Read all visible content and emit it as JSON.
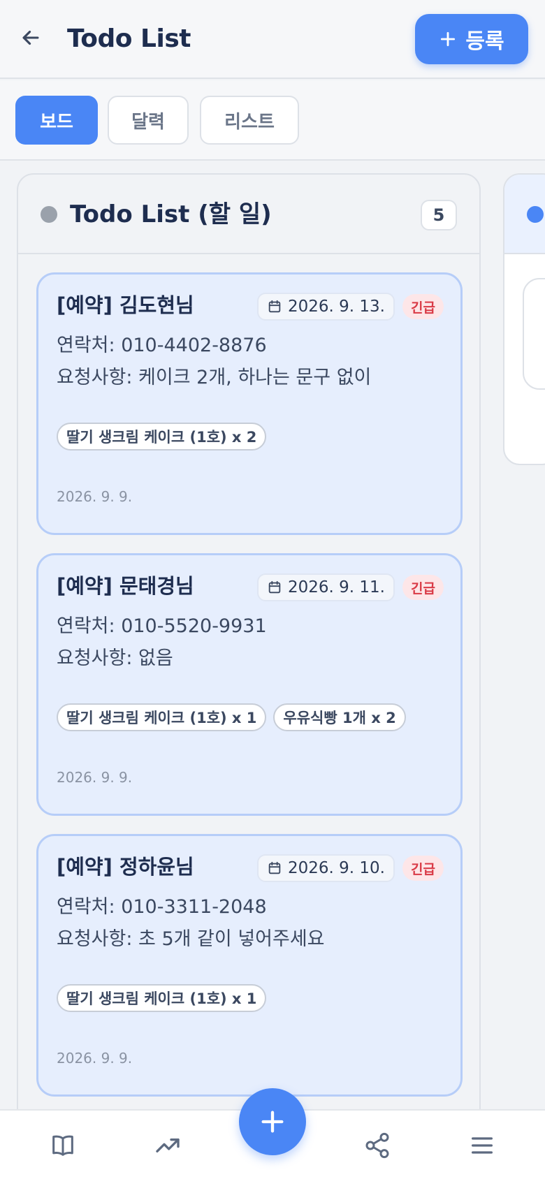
{
  "header": {
    "title": "Todo List",
    "add_button_label": "등록"
  },
  "view_tabs": [
    {
      "label": "보드",
      "active": true
    },
    {
      "label": "달력",
      "active": false
    },
    {
      "label": "리스트",
      "active": false
    }
  ],
  "board": {
    "column_title": "Todo List (할 일)",
    "column_count": "5",
    "cards": [
      {
        "title": "[예약] 김도현님",
        "due_date": "2026. 9. 13.",
        "priority": "긴급",
        "contact": "연락처: 010-4402-8876",
        "request": "요청사항: 케이크 2개, 하나는 문구 없이",
        "tags": [
          "딸기 생크림 케이크 (1호) x 2"
        ],
        "created": "2026. 9. 9."
      },
      {
        "title": "[예약] 문태경님",
        "due_date": "2026. 9. 11.",
        "priority": "긴급",
        "contact": "연락처: 010-5520-9931",
        "request": "요청사항: 없음",
        "tags": [
          "딸기 생크림 케이크 (1호) x 1",
          "우유식빵 1개 x 2"
        ],
        "created": "2026. 9. 9."
      },
      {
        "title": "[예약] 정하윤님",
        "due_date": "2026. 9. 10.",
        "priority": "긴급",
        "contact": "연락처: 010-3311-2048",
        "request": "요청사항: 초 5개 같이 넣어주세요",
        "tags": [
          "딸기 생크림 케이크 (1호) x 1"
        ],
        "created": "2026. 9. 9."
      }
    ]
  },
  "bottom_nav": [
    "book-icon",
    "trending-up-icon",
    "plus-icon",
    "share-icon",
    "menu-icon"
  ],
  "colors": {
    "accent": "#4a86f5",
    "card_bg": "#e6eefd",
    "urgent_text": "#d93a46",
    "urgent_bg": "#fde6e8"
  }
}
